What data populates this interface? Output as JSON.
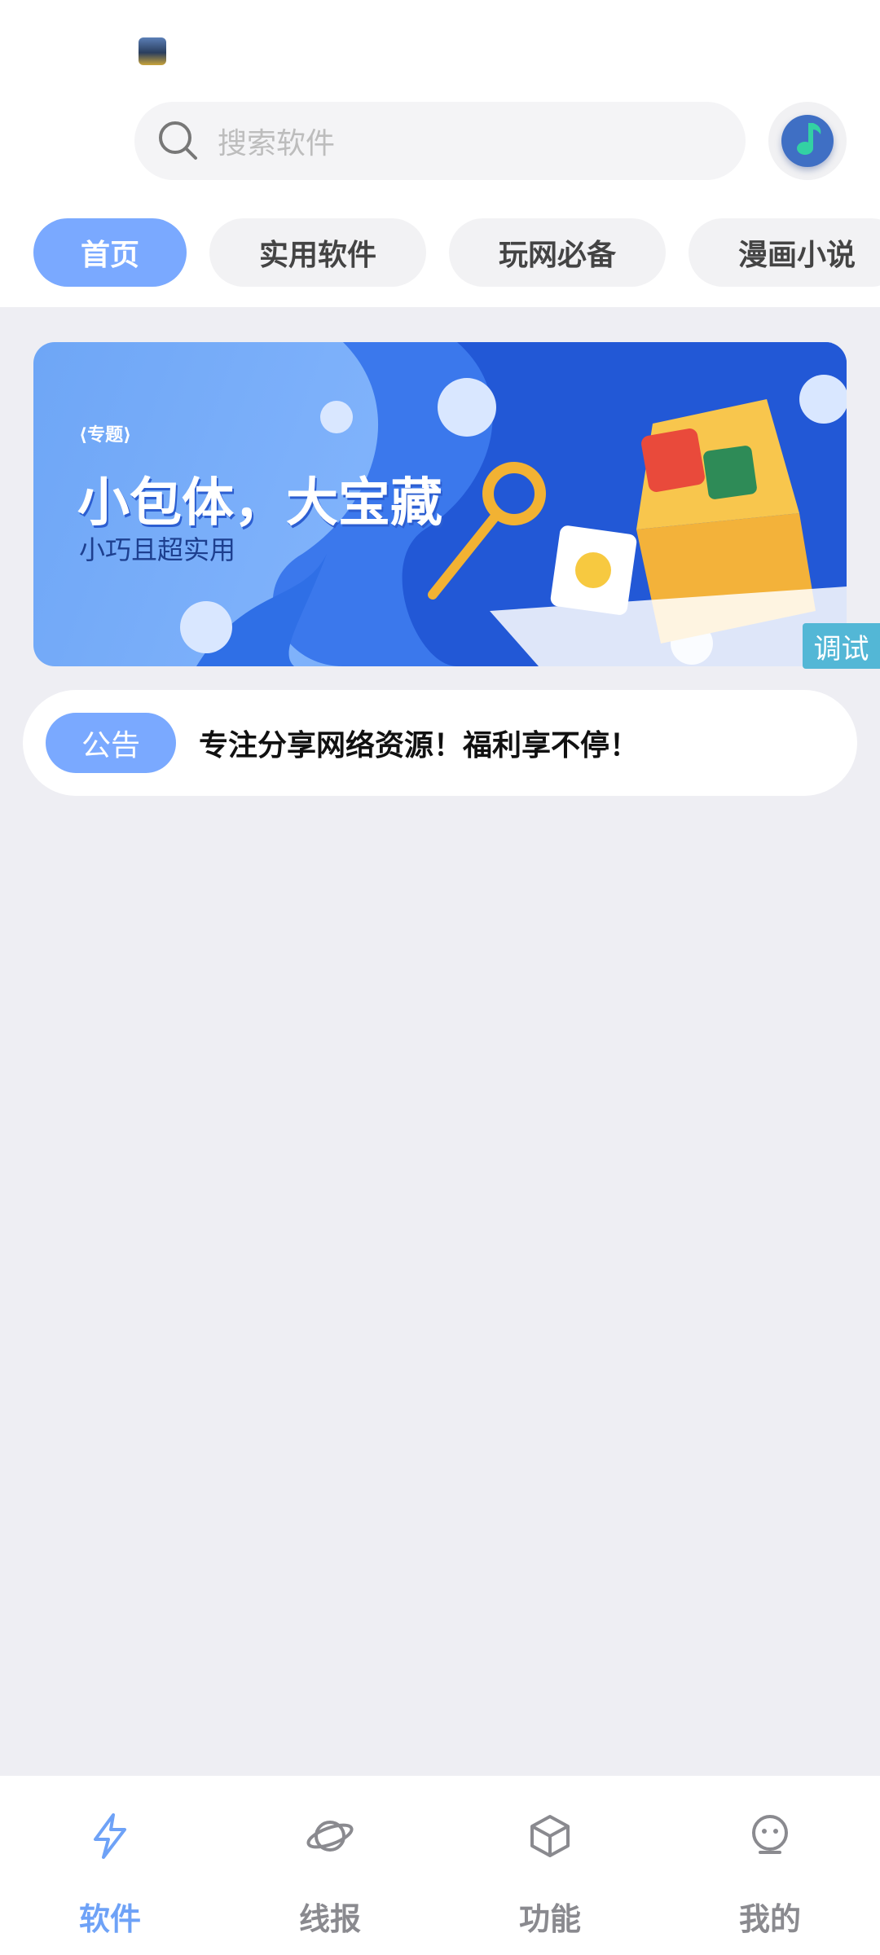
{
  "search": {
    "placeholder": "搜索软件"
  },
  "tabs": [
    {
      "label": "首页",
      "active": true
    },
    {
      "label": "实用软件",
      "active": false
    },
    {
      "label": "玩网必备",
      "active": false
    },
    {
      "label": "漫画小说",
      "active": false
    }
  ],
  "banner": {
    "tag": "专题",
    "title": "小包体，大宝藏",
    "subtitle": "小巧且超实用"
  },
  "debug_label": "调试",
  "notice": {
    "badge": "公告",
    "text": "专注分享网络资源！福利享不停！"
  },
  "bottom_nav": [
    {
      "label": "软件",
      "icon": "lightning-icon",
      "active": true
    },
    {
      "label": "线报",
      "icon": "planet-icon",
      "active": false
    },
    {
      "label": "功能",
      "icon": "cube-icon",
      "active": false
    },
    {
      "label": "我的",
      "icon": "robot-face-icon",
      "active": false
    }
  ],
  "colors": {
    "accent": "#7aa9ff",
    "nav_active": "#6ea2f7",
    "background": "#eeeef3"
  }
}
